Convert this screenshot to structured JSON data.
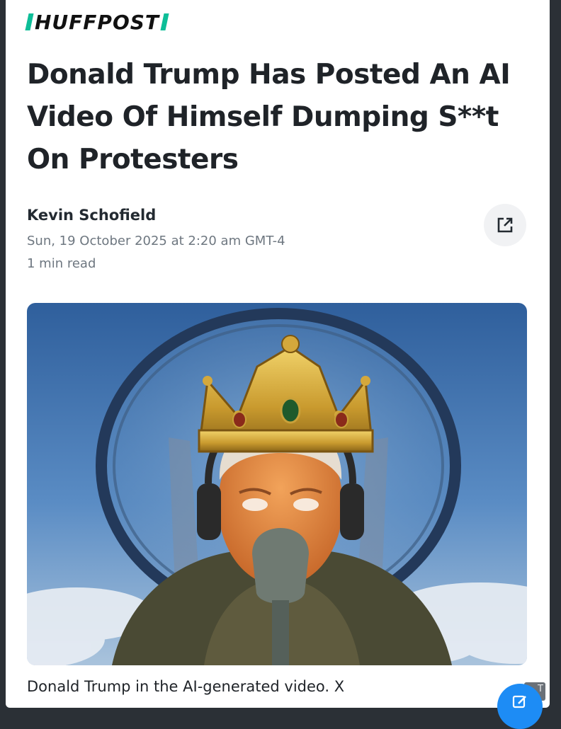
{
  "publication": {
    "name": "HUFFPOST",
    "accent_color": "#0dbe98"
  },
  "article": {
    "title": "Donald Trump Has Posted An AI Video Of Himself Dumping S**t On Protesters",
    "author": "Kevin Schofield",
    "published": "Sun, 19 October 2025 at 2:20 am GMT-4",
    "read_time": "1 min read",
    "image_caption": "Donald Trump in the AI-generated video. X"
  },
  "actions": {
    "share_icon": "external-link-icon",
    "compose_icon": "pencil-icon",
    "fab_color": "#1d8cf5"
  },
  "overlay": {
    "corner_badge": "T"
  }
}
